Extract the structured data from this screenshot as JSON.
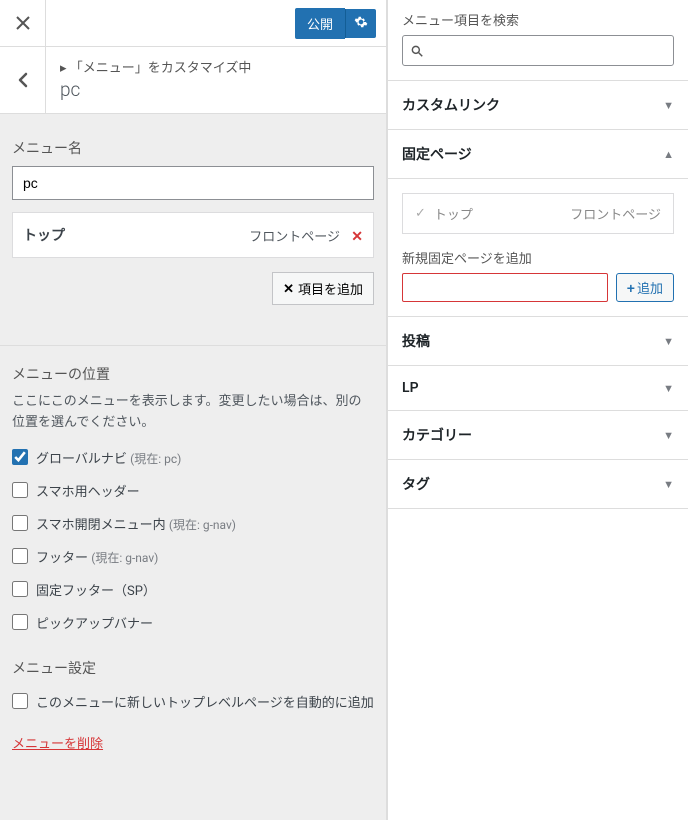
{
  "topbar": {
    "publish_label": "公開",
    "settings_icon": "gear"
  },
  "breadcrumb": {
    "prefix": "▸ 「メニュー」をカスタマイズ中",
    "title": "pc"
  },
  "menu_name": {
    "label": "メニュー名",
    "value": "pc"
  },
  "menu_items": [
    {
      "title": "トップ",
      "type": "フロントページ"
    }
  ],
  "buttons": {
    "add_items": "項目を追加"
  },
  "menu_position": {
    "heading": "メニューの位置",
    "description": "ここにこのメニューを表示します。変更したい場合は、別の位置を選んでください。"
  },
  "locations": [
    {
      "label": "グローバルナビ",
      "sub": "(現在: pc)",
      "checked": true
    },
    {
      "label": "スマホ用ヘッダー",
      "sub": "",
      "checked": false
    },
    {
      "label": "スマホ開閉メニュー内",
      "sub": "(現在: g-nav)",
      "checked": false
    },
    {
      "label": "フッター",
      "sub": "(現在: g-nav)",
      "checked": false
    },
    {
      "label": "固定フッター（SP）",
      "sub": "",
      "checked": false
    },
    {
      "label": "ピックアップバナー",
      "sub": "",
      "checked": false
    }
  ],
  "menu_settings": {
    "heading": "メニュー設定",
    "auto_add_label": "このメニューに新しいトップレベルページを自動的に追加"
  },
  "delete_menu_label": "メニューを削除",
  "right": {
    "search_label": "メニュー項目を検索",
    "search_placeholder": "",
    "sections": {
      "custom_link": "カスタムリンク",
      "pages": "固定ページ",
      "posts": "投稿",
      "lp": "LP",
      "categories": "カテゴリー",
      "tags": "タグ"
    },
    "page_items": [
      {
        "title": "トップ",
        "type": "フロントページ"
      }
    ],
    "add_page_label": "新規固定ページを追加",
    "add_button": "追加"
  }
}
